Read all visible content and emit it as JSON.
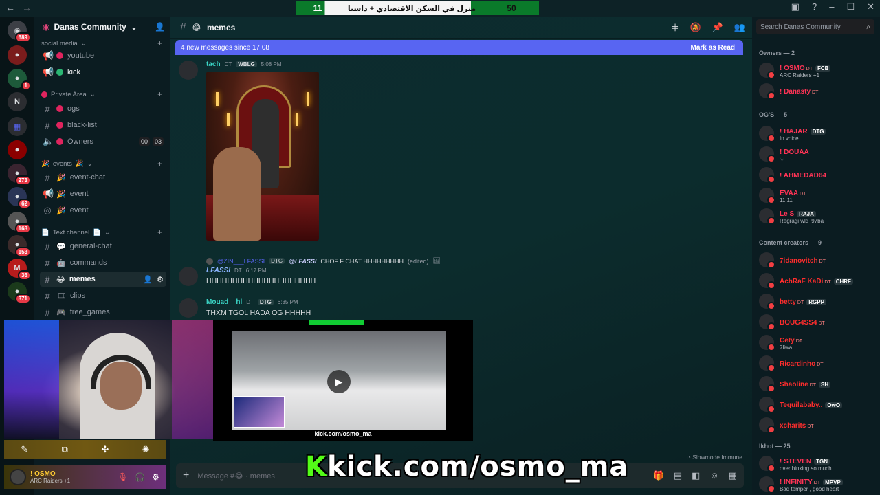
{
  "topbar": {
    "back_icon": "arrow-left-icon",
    "score_left": "11",
    "score_text": "منزل في السكن الاقتصادي + داسيا",
    "score_right": "50"
  },
  "rail": {
    "servers": [
      {
        "badge": "689"
      },
      {
        "badge": ""
      },
      {
        "badge": "1"
      },
      {
        "label": "N"
      },
      {
        "badge": ""
      },
      {
        "badge": ""
      },
      {
        "badge": "273"
      },
      {
        "badge": "62"
      },
      {
        "badge": "168"
      },
      {
        "badge": "153"
      },
      {
        "badge": "36"
      },
      {
        "badge": "371"
      }
    ]
  },
  "server": {
    "name": "Danas Community",
    "categories": {
      "social": "social media",
      "private": "Private Area",
      "events": "events",
      "text": "Text channel"
    },
    "channels": {
      "youtube": "youtube",
      "kick": "kick",
      "ogs": "ogs",
      "black_list": "black-list",
      "owners": "Owners",
      "owners_count_a": "00",
      "owners_count_b": "03",
      "event_chat": "event-chat",
      "event1": "event",
      "event2": "event",
      "general_chat": "general-chat",
      "commands": "commands",
      "memes": "memes",
      "clips": "clips",
      "free_games": "free_games"
    }
  },
  "user": {
    "name": "! OSMO",
    "status": "ARC Raiders +1"
  },
  "channel": {
    "name": "memes",
    "new_messages": "4 new messages since 17:08",
    "mark_read": "Mark as Read",
    "slowmode": "Slowmode Immune",
    "composer_placeholder": "Message #",
    "composer_channel": "memes"
  },
  "messages": [
    {
      "author": "tach",
      "suffix": "DT",
      "tag": "WBLG",
      "time": "5:08 PM"
    },
    {
      "author": "LFASSI",
      "suffix": "DT",
      "time": "6:17 PM",
      "text": "HHHHHHHHHHHHHHHHHHHHH",
      "reply_author": "@ZIN___LFASSI",
      "reply_tag": "DTG",
      "reply_mention": "@LFASSI",
      "reply_text": "CHOF F CHAT HHHHHHHHH",
      "reply_edited": "(edited)"
    },
    {
      "author": "Mouad__hl",
      "suffix": "DT",
      "tag": "DTG",
      "time": "6:35 PM",
      "text": "THXM TGOL HADA OG HHHHH"
    }
  ],
  "stream": {
    "video_url": "kick.com/osmo_ma",
    "big_k": "K",
    "big_text": "kick.com/osmo_ma"
  },
  "members": {
    "search_placeholder": "Search Danas Community",
    "groups": [
      {
        "title": "Owners — 2",
        "list": [
          {
            "name": "! OSMO",
            "suffix": "DT",
            "tag": "FCB",
            "status": "ARC Raiders +1",
            "color": "#ff3355"
          },
          {
            "name": "! Danasty",
            "suffix": "DT",
            "color": "#ff3355"
          }
        ]
      },
      {
        "title": "OG'S — 5",
        "list": [
          {
            "name": "! HAJAR",
            "tag": "DTG",
            "status": "In voice",
            "color": "#ff3355"
          },
          {
            "name": "! DOUAA",
            "status": "♡",
            "color": "#ff3355"
          },
          {
            "name": "! AHMEDAD64",
            "status": "",
            "color": "#ff3355"
          },
          {
            "name": "EVAA",
            "suffix": "DT",
            "status": "11:11",
            "color": "#ff3355"
          },
          {
            "name": "Le S",
            "tag": "RAJA",
            "status": "Regragi wld l97ba",
            "color": "#ff3355"
          }
        ]
      },
      {
        "title": "Content creators — 9",
        "list": [
          {
            "name": "7idanovitch",
            "suffix": "DT",
            "color": "#ff2d2d"
          },
          {
            "name": "AchRaF KaDi",
            "suffix": "DT",
            "tag": "CHRF",
            "color": "#ff2d2d"
          },
          {
            "name": "betty",
            "suffix": "DT",
            "tag": "RGPP",
            "color": "#ff2d2d"
          },
          {
            "name": "BOUG4SS4",
            "suffix": "DT",
            "color": "#ff2d2d"
          },
          {
            "name": "Cety",
            "suffix": "DT",
            "status": "7liwa",
            "color": "#ff2d2d"
          },
          {
            "name": "Ricardinho",
            "suffix": "DT",
            "color": "#ff2d2d"
          },
          {
            "name": "Shaoline",
            "suffix": "DT",
            "tag": "SH",
            "color": "#ff2d2d"
          },
          {
            "name": "Tequilababy..",
            "tag": "OwO",
            "color": "#ff2d2d"
          },
          {
            "name": "xcharits",
            "suffix": "DT",
            "color": "#ff2d2d"
          }
        ]
      },
      {
        "title": "lkhot — 25",
        "list": [
          {
            "name": "! STEVEN",
            "tag": "TGN",
            "status": "overthinking so much",
            "color": "#ff3355"
          },
          {
            "name": "! INFINITY",
            "suffix": "DT",
            "tag": "MPVP",
            "status": "Bad temper , good heart",
            "color": "#ff3355"
          }
        ]
      }
    ]
  },
  "colors": {
    "accent": "#5865f2",
    "kick_green": "#53fc18"
  }
}
